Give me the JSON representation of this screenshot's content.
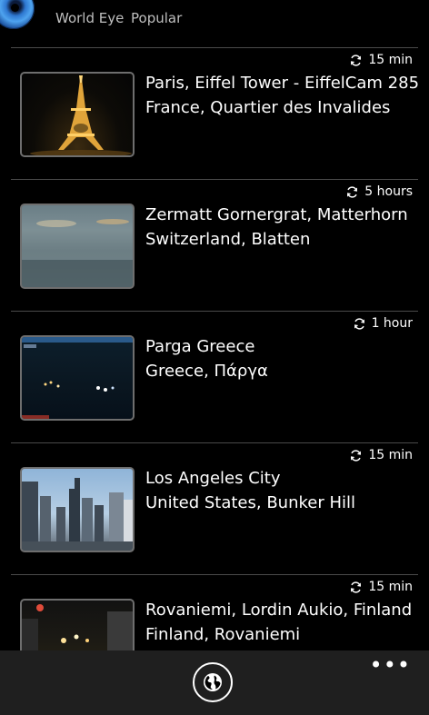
{
  "header": {
    "app_name": "World Eye",
    "section": "Popular",
    "logo_icon": "eye-globe-logo"
  },
  "webcams": [
    {
      "title": "Paris, Eiffel Tower - EiffelCam 285",
      "subtitle": "France, Quartier des Invalides",
      "refresh": "15 min",
      "thumbnail": "eiffel-tower-night"
    },
    {
      "title": "Zermatt Gornergrat, Matterhorn",
      "subtitle": "Switzerland, Blatten",
      "refresh": "5 hours",
      "thumbnail": "foggy-mountain"
    },
    {
      "title": "Parga Greece",
      "subtitle": "Greece, Πάργα",
      "refresh": "1 hour",
      "thumbnail": "harbor-night"
    },
    {
      "title": "Los Angeles City",
      "subtitle": "United States, Bunker Hill",
      "refresh": "15 min",
      "thumbnail": "city-skyline-day"
    },
    {
      "title": "Rovaniemi, Lordin Aukio, Finland",
      "subtitle": "Finland, Rovaniemi",
      "refresh": "15 min",
      "thumbnail": "street-night"
    }
  ],
  "appbar": {
    "primary_icon": "globe-icon",
    "more_label": "•••"
  },
  "colors": {
    "background": "#000000",
    "divider": "#4a4a4a",
    "appbar": "#1f1f1f",
    "secondary_text": "#bfbfbf"
  }
}
